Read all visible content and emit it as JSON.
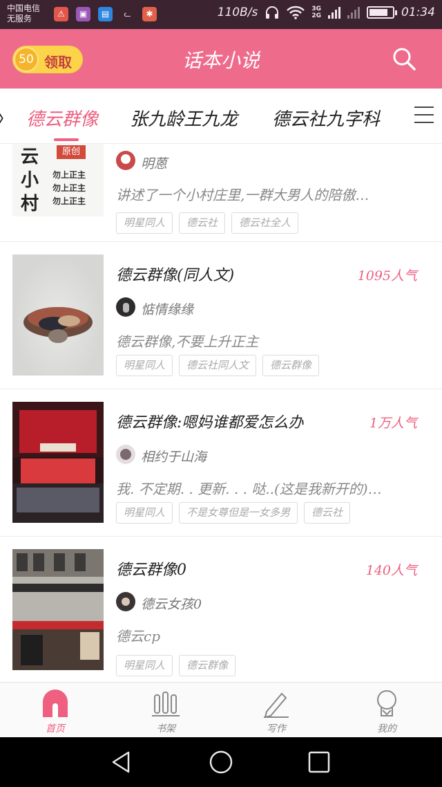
{
  "status_bar": {
    "carrier_line1": "中国电信",
    "carrier_line2": "无服务",
    "net_speed": "110B/s",
    "network_type_top": "3G",
    "network_type_bottom": "2G",
    "time": "01:34",
    "battery_level": 0.8,
    "icons": [
      "warning-app-icon",
      "gallery-app-icon",
      "sim-app-icon",
      "cat-app-icon",
      "toolbox-app-icon",
      "headphones-icon",
      "wifi-icon",
      "signal-icon",
      "battery-icon"
    ]
  },
  "header": {
    "coin_value": "50",
    "claim_label": "领取",
    "app_title": "话本小说",
    "accent_color": "#ee6b8c"
  },
  "tabs": {
    "partial_left": "〉",
    "items": [
      {
        "label": "德云群像",
        "active": true
      },
      {
        "label": "张九龄王九龙",
        "active": false
      },
      {
        "label": "德云社九字科",
        "active": false
      }
    ]
  },
  "books": [
    {
      "title": "",
      "popularity": "",
      "author": "明蒽",
      "description": "讲述了一个小村庄里,一群大男人的陪傲…",
      "tags": [
        "明星同人",
        "德云社",
        "德云社全人"
      ],
      "cover_text": [
        "云",
        "小",
        "村"
      ],
      "cover_badge": "原创",
      "cover_lines": [
        "勿上正主",
        "勿上正主",
        "勿上正主"
      ]
    },
    {
      "title": "德云群像(同人文)",
      "popularity": "1095人气",
      "author": "惦情缘缘",
      "description": "德云群像,不要上升正主",
      "tags": [
        "明星同人",
        "德云社同人文",
        "德云群像"
      ]
    },
    {
      "title": "德云群像:嗯妈谁都爱怎么办",
      "popularity": "1万人气",
      "author": "相约于山海",
      "description": "我. 不定期. . 更新. . . 哒..(这是我新开的)…",
      "tags": [
        "明星同人",
        "不是女尊但是一女多男",
        "德云社"
      ]
    },
    {
      "title": "德云群像0",
      "popularity": "140人气",
      "author": "德云女孩0",
      "description": "德云cp",
      "tags": [
        "明星同人",
        "德云群像"
      ]
    }
  ],
  "bottom_nav": {
    "items": [
      {
        "label": "首页",
        "icon": "home-icon",
        "active": true
      },
      {
        "label": "书架",
        "icon": "bookshelf-icon",
        "active": false
      },
      {
        "label": "写作",
        "icon": "pencil-icon",
        "active": false
      },
      {
        "label": "我的",
        "icon": "profile-icon",
        "active": false
      }
    ]
  },
  "system_nav": {
    "icons": [
      "back-icon",
      "home-circle-icon",
      "recents-icon"
    ]
  }
}
